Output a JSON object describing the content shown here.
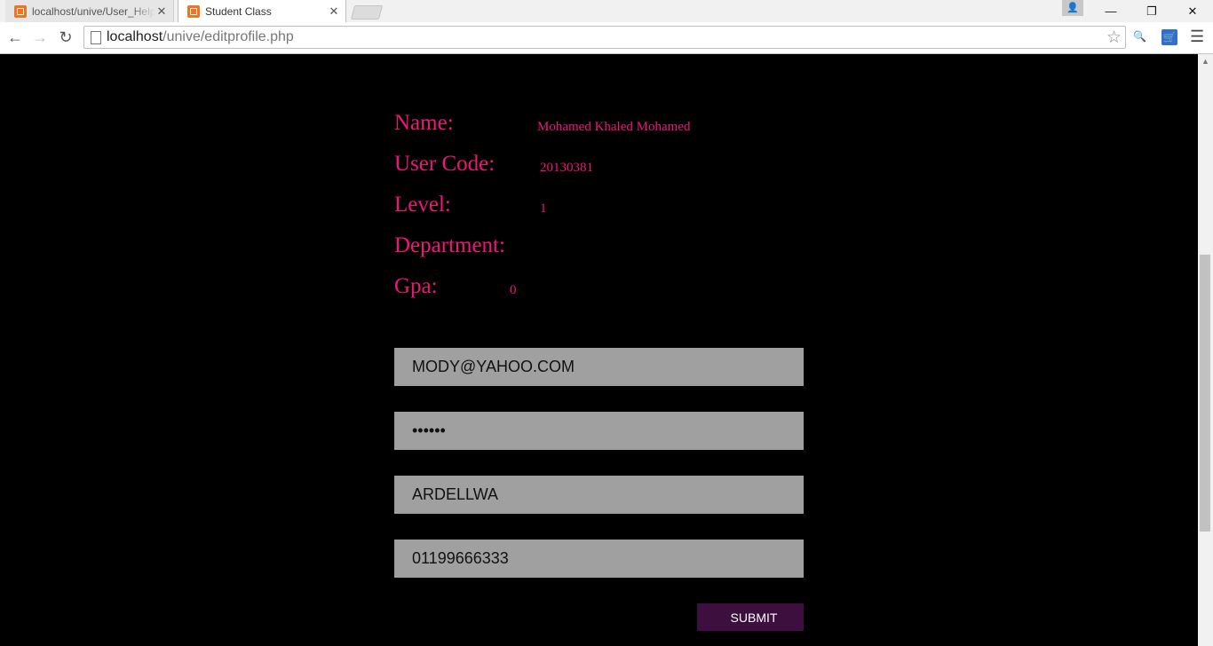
{
  "browser": {
    "tabs": [
      {
        "title": "localhost/unive/User_Help",
        "active": false
      },
      {
        "title": "Student Class",
        "active": true
      }
    ],
    "url": {
      "host": "localhost",
      "path": "/unive/editprofile.php"
    }
  },
  "colors": {
    "label": "#f0157a",
    "field_bg": "#a0a0a0",
    "submit_bg": "#3d0f3f",
    "page_bg": "#000000"
  },
  "profile": {
    "name_label": "Name:",
    "name_value": "Mohamed Khaled Mohamed",
    "code_label": "User Code:",
    "code_value": "20130381",
    "level_label": "Level:",
    "level_value": "1",
    "department_label": "Department:",
    "department_value": "",
    "gpa_label": "Gpa:",
    "gpa_value": "0"
  },
  "form": {
    "email": "MODY@YAHOO.COM",
    "password": "••••••",
    "address": "ARDELLWA",
    "phone": "01199666333",
    "submit_label": "SUBMIT"
  }
}
